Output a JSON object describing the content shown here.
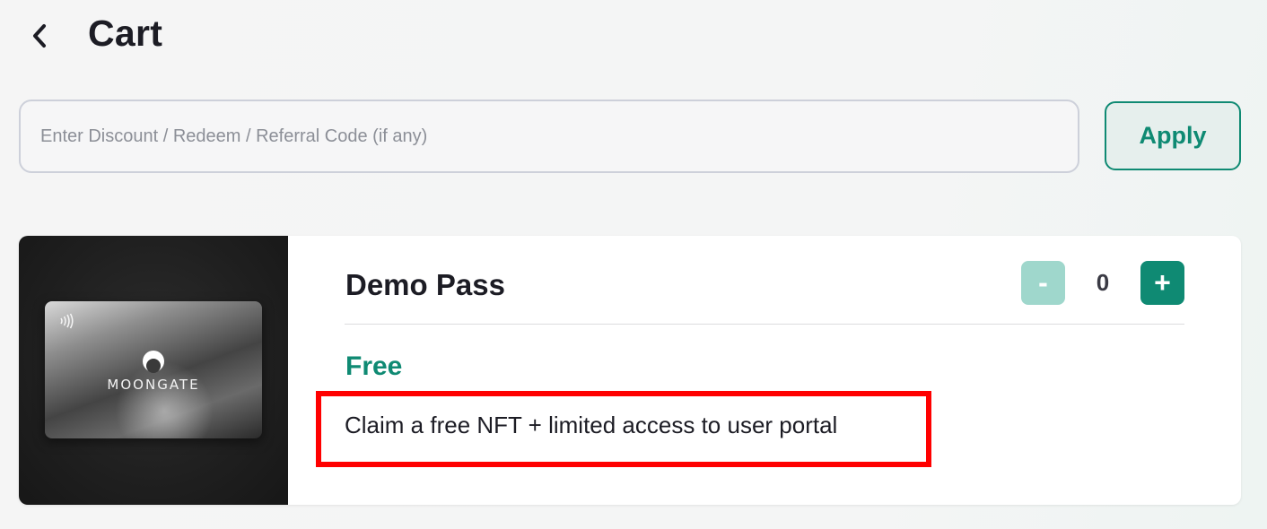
{
  "header": {
    "title": "Cart",
    "back_icon": "chevron-left-icon"
  },
  "discount": {
    "placeholder": "Enter Discount / Redeem / Referral Code (if any)",
    "value": "",
    "apply_label": "Apply"
  },
  "product": {
    "name": "Demo Pass",
    "price": "Free",
    "description": "Claim a free NFT + limited access to user portal",
    "quantity": "0",
    "minus_label": "-",
    "plus_label": "+",
    "image": {
      "brand_text": "MOONGATE",
      "icons": [
        "nfc-icon",
        "moon-logo-icon"
      ]
    }
  },
  "colors": {
    "accent": "#0f8a73",
    "accent_light": "#9fd7cc",
    "highlight": "#ff0000",
    "text": "#1c1c24",
    "placeholder": "#8c8f97"
  }
}
